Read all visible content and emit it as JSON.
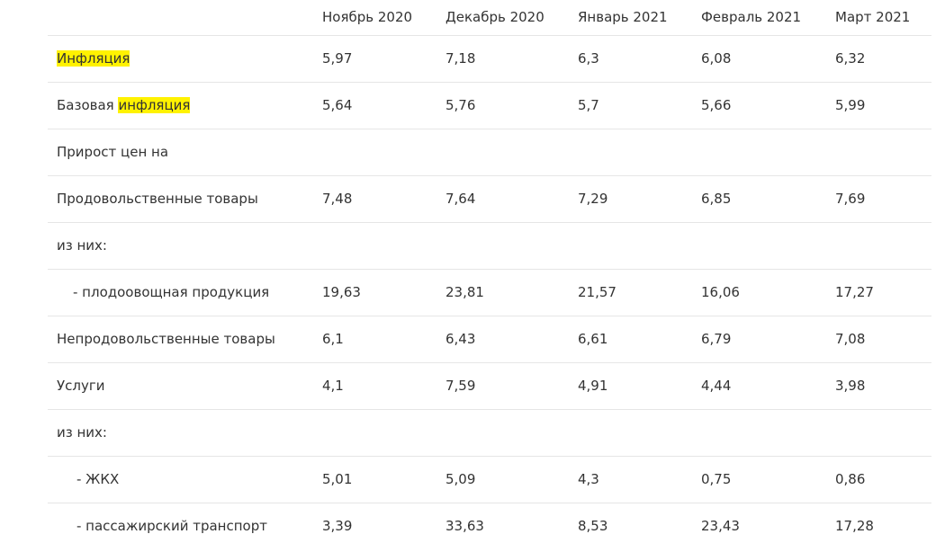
{
  "table": {
    "headers": [
      "",
      "Ноябрь 2020",
      "Декабрь 2020",
      "Январь 2021",
      "Февраль 2021",
      "Март 2021"
    ],
    "rows": [
      {
        "label_pre": "",
        "label_hl": "Инфляция",
        "values": [
          "5,97",
          "7,18",
          "6,3",
          "6,08",
          "6,32"
        ]
      },
      {
        "label_pre": "Базовая ",
        "label_hl": "инфляция",
        "values": [
          "5,64",
          "5,76",
          "5,7",
          "5,66",
          "5,99"
        ]
      },
      {
        "label": "Прирост цен на",
        "values": [
          "",
          "",
          "",
          "",
          ""
        ]
      },
      {
        "label": "Продовольственные товары",
        "values": [
          "7,48",
          "7,64",
          "7,29",
          "6,85",
          "7,69"
        ]
      },
      {
        "label": "из них:",
        "values": [
          "",
          "",
          "",
          "",
          ""
        ]
      },
      {
        "label": "- плодоовощная продукция",
        "values": [
          "19,63",
          "23,81",
          "21,57",
          "16,06",
          "17,27"
        ]
      },
      {
        "label": "Непродовольственные товары",
        "values": [
          "6,1",
          "6,43",
          "6,61",
          "6,79",
          "7,08"
        ]
      },
      {
        "label": "Услуги",
        "values": [
          "4,1",
          "7,59",
          "4,91",
          "4,44",
          "3,98"
        ]
      },
      {
        "label": "из них:",
        "values": [
          "",
          "",
          "",
          "",
          ""
        ]
      },
      {
        "label": "- ЖКХ",
        "values": [
          "5,01",
          "5,09",
          "4,3",
          "0,75",
          "0,86"
        ]
      },
      {
        "label": "- пассажирский транспорт",
        "values": [
          "3,39",
          "33,63",
          "8,53",
          "23,43",
          "17,28"
        ]
      }
    ]
  },
  "colors": {
    "highlight": "#fff200",
    "text": "#333333",
    "divider": "#e6e6e6"
  }
}
